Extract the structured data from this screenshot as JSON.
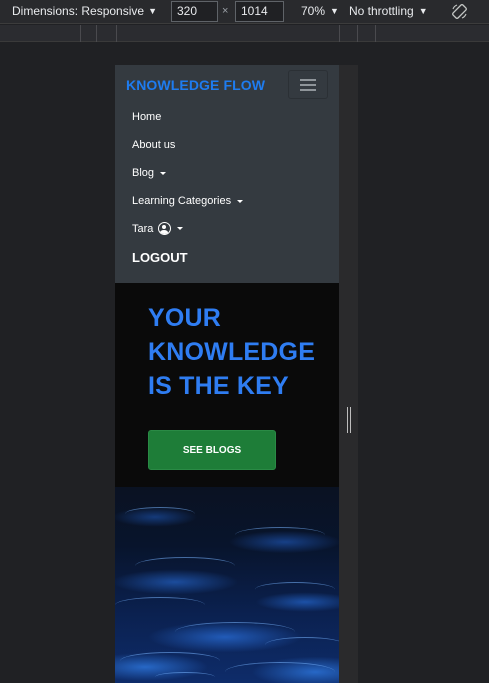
{
  "devtools": {
    "dimensions_label": "Dimensions: Responsive",
    "width_value": "320",
    "times_sign": "×",
    "height_value": "1014",
    "zoom": "70%",
    "throttling": "No throttling"
  },
  "site": {
    "brand": "KNOWLEDGE FLOW",
    "nav": {
      "home": "Home",
      "about": "About us",
      "blog": "Blog",
      "categories": "Learning Categories",
      "user": "Tara",
      "logout": "LOGOUT"
    },
    "hero": {
      "title_line1": "YOUR",
      "title_line2": "KNOWLEDGE",
      "title_line3": "IS THE KEY",
      "button": "SEE BLOGS"
    }
  },
  "colors": {
    "brand_blue": "#1e7cf0",
    "hero_blue": "#2f7df2",
    "button_green": "#1e7d38",
    "navbar_bg": "#343a40"
  },
  "icons": {
    "dropdown": "caret-down-icon",
    "toggler": "hamburger-menu-icon",
    "user": "user-circle-icon",
    "rotate": "rotate-icon"
  }
}
